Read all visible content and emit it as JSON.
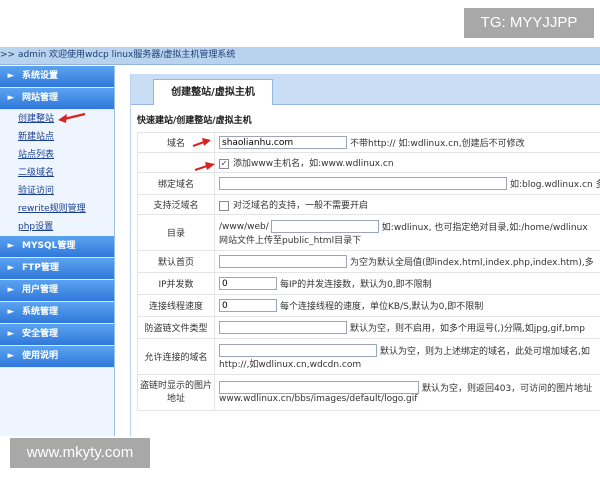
{
  "watermarks": {
    "top": "TG: MYYJJPP",
    "bottom": "www.mkyty.com"
  },
  "header": {
    "breadcrumb": ">> admin 欢迎使用wdcp linux服务器/虚拟主机管理系统"
  },
  "sidebar": {
    "menus": [
      {
        "label": "系统设置"
      },
      {
        "label": "网站管理"
      },
      {
        "label": "MYSQL管理"
      },
      {
        "label": "FTP管理"
      },
      {
        "label": "用户管理"
      },
      {
        "label": "系统管理"
      },
      {
        "label": "安全管理"
      },
      {
        "label": "使用说明"
      }
    ],
    "site_sub_items": [
      {
        "label": "创建整站"
      },
      {
        "label": "新建站点"
      },
      {
        "label": "站点列表"
      },
      {
        "label": "二级域名"
      },
      {
        "label": "验证访问"
      },
      {
        "label": "rewrite规则管理"
      },
      {
        "label": "php设置"
      }
    ],
    "arrow_glyph": "►"
  },
  "main": {
    "tab": "创建整站/虚拟主机",
    "heading": "快速建站/创建整站/虚拟主机",
    "fields": {
      "domain": {
        "label": "域名",
        "value": "shaolianhu.com",
        "note": "不带http:// 如:wdlinux.cn,创建后不可修改"
      },
      "www": {
        "label": "添加www主机名，如:www.wdlinux.cn",
        "checked": true
      },
      "bind": {
        "label": "绑定域名",
        "value": "",
        "note": "如:blog.wdlinux.cn 多"
      },
      "wildcard": {
        "label": "支持泛域名",
        "checkbox_label": "对泛域名的支持，一般不需要开启"
      },
      "dir": {
        "label": "目录",
        "prefix": "/www/web/",
        "value": "",
        "note": "如:wdlinux, 也可指定绝对目录,如:/home/wdlinux",
        "note2": "网站文件上传至public_html目录下"
      },
      "index": {
        "label": "默认首页",
        "value": "",
        "note": "为空为默认全局值(即index.html,index.php,index.htm),多"
      },
      "ip_conn": {
        "label": "IP并发数",
        "value": "0",
        "note": "每IP的并发连接数，默认为0,即不限制"
      },
      "speed": {
        "label": "连接线程速度",
        "value": "0",
        "note": "每个连接线程的速度，单位KB/S,默认为0,即不限制"
      },
      "hotlink": {
        "label": "防盗链文件类型",
        "value": "",
        "note": "默认为空，则不启用，如多个用逗号(,)分隔,如jpg,gif,bmp"
      },
      "allowed": {
        "label": "允许连接的域名",
        "value": "",
        "note": "默认为空，则为上述绑定的域名，此处可增加域名,如",
        "note2": "http://,如wdlinux.cn,wdcdn.com"
      },
      "hotlink_img": {
        "label": "盗链时显示的图片地址",
        "value": "",
        "note": "默认为空，则返回403，可访问的图片地址",
        "note2": "www.wdlinux.cn/bbs/images/default/logo.gif"
      }
    }
  },
  "colors": {
    "menu_blue": "#2f78d9",
    "arrow_red": "#d9231f"
  }
}
